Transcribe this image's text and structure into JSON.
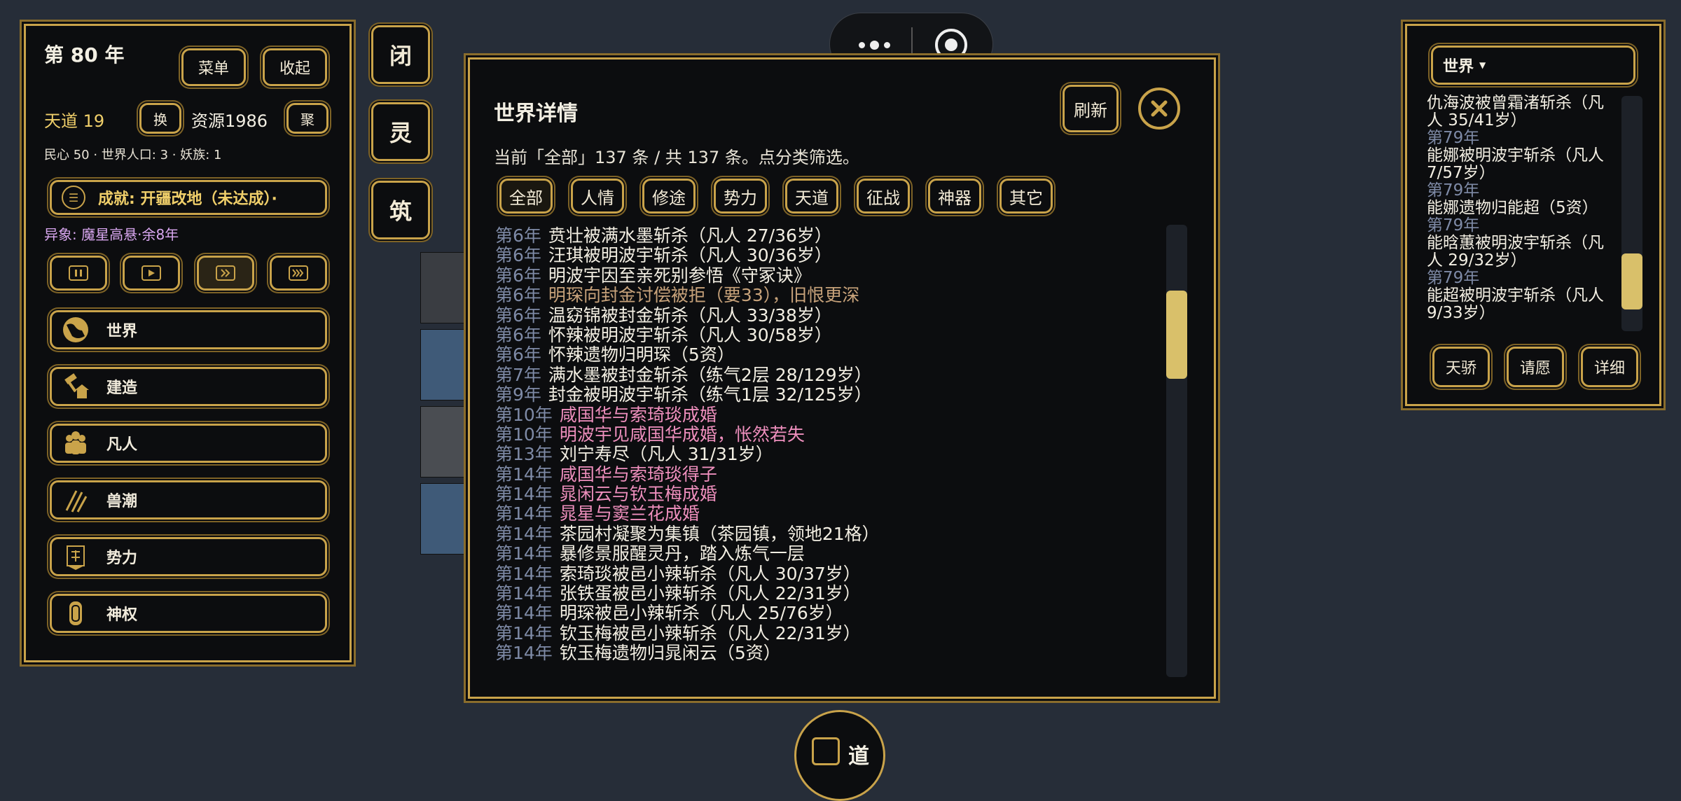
{
  "left": {
    "year": "第 80 年",
    "menu_label": "菜单",
    "collapse_label": "收起",
    "tiandao": "天道 19",
    "swap_label": "换",
    "resource": "资源1986",
    "gather_label": "聚",
    "stats": "民心 50 · 世界人口: 3 · 妖族: 1",
    "achievement": "成就: 开疆改地（未达成）·",
    "omen": "异象: 魔星高悬·余8年",
    "nav": [
      {
        "label": "世界",
        "icon": "globe-icon"
      },
      {
        "label": "建造",
        "icon": "hammer-house-icon"
      },
      {
        "label": "凡人",
        "icon": "people-icon"
      },
      {
        "label": "兽潮",
        "icon": "claw-icon"
      },
      {
        "label": "势力",
        "icon": "banner-icon"
      },
      {
        "label": "神权",
        "icon": "tablet-icon"
      }
    ]
  },
  "side_buttons": [
    "闭",
    "灵",
    "筑"
  ],
  "top_capsule": {
    "more_icon": "more-dots-icon",
    "close_icon": "target-icon"
  },
  "bottom_button": "道",
  "dialog": {
    "title": "世界详情",
    "refresh_label": "刷新",
    "summary": "当前「全部」137 条 / 共 137 条。点分类筛选。",
    "filters": [
      "全部",
      "人情",
      "修途",
      "势力",
      "天道",
      "征战",
      "神器",
      "其它"
    ],
    "log": [
      {
        "year": "第6年",
        "text": "贲壮被满水墨斩杀（凡人 27/36岁）",
        "kind": "normal"
      },
      {
        "year": "第6年",
        "text": "汪琪被明波宇斩杀（凡人 30/36岁）",
        "kind": "normal"
      },
      {
        "year": "第6年",
        "text": "明波宇因至亲死别参悟《守冢诀》",
        "kind": "normal"
      },
      {
        "year": "第6年",
        "text": "明琛向封金讨偿被拒（要33），旧恨更深",
        "kind": "dim"
      },
      {
        "year": "第6年",
        "text": "温窈锦被封金斩杀（凡人 33/38岁）",
        "kind": "normal"
      },
      {
        "year": "第6年",
        "text": "怀辣被明波宇斩杀（凡人 30/58岁）",
        "kind": "normal"
      },
      {
        "year": "第6年",
        "text": "怀辣遗物归明琛（5资）",
        "kind": "normal"
      },
      {
        "year": "第7年",
        "text": "满水墨被封金斩杀（练气2层 28/129岁）",
        "kind": "normal"
      },
      {
        "year": "第9年",
        "text": "封金被明波宇斩杀（练气1层 32/125岁）",
        "kind": "normal"
      },
      {
        "year": "第10年",
        "text": "咸国华与索琦琰成婚",
        "kind": "pink"
      },
      {
        "year": "第10年",
        "text": "明波宇见咸国华成婚，怅然若失",
        "kind": "pink"
      },
      {
        "year": "第13年",
        "text": "刘宁寿尽（凡人 31/31岁）",
        "kind": "normal"
      },
      {
        "year": "第14年",
        "text": "咸国华与索琦琰得子",
        "kind": "pink"
      },
      {
        "year": "第14年",
        "text": "晁闲云与钦玉梅成婚",
        "kind": "pink"
      },
      {
        "year": "第14年",
        "text": "晁星与窦兰花成婚",
        "kind": "pink"
      },
      {
        "year": "第14年",
        "text": "茶园村凝聚为集镇（茶园镇，领地21格）",
        "kind": "normal"
      },
      {
        "year": "第14年",
        "text": "暴修景服醒灵丹，踏入炼气一层",
        "kind": "normal"
      },
      {
        "year": "第14年",
        "text": "索琦琰被邑小辣斩杀（凡人 30/37岁）",
        "kind": "normal"
      },
      {
        "year": "第14年",
        "text": "张铁蛋被邑小辣斩杀（凡人 22/31岁）",
        "kind": "normal"
      },
      {
        "year": "第14年",
        "text": "明琛被邑小辣斩杀（凡人 25/76岁）",
        "kind": "normal"
      },
      {
        "year": "第14年",
        "text": "钦玉梅被邑小辣斩杀（凡人 22/31岁）",
        "kind": "normal"
      },
      {
        "year": "第14年",
        "text": "钦玉梅遗物归晁闲云（5资）",
        "kind": "normal"
      }
    ],
    "scroll_position": 0.18
  },
  "right": {
    "select_value": "世界",
    "entries": [
      {
        "text": "仇海波被曾霜渚斩杀（凡人 35/41岁）"
      },
      {
        "year": "第79年",
        "text": "能娜被明波宇斩杀（凡人 7/57岁）"
      },
      {
        "year": "第79年",
        "text": "能娜遗物归能超（5资）"
      },
      {
        "year": "第79年",
        "text": "能晗蕙被明波宇斩杀（凡人 29/32岁）"
      },
      {
        "year": "第79年",
        "text": "能超被明波宇斩杀（凡人 9/33岁）"
      }
    ],
    "buttons": [
      "天骄",
      "请愿",
      "详细"
    ],
    "scroll_position": 0.88
  },
  "colors": {
    "gold": "#c9a34a",
    "panel": "#0c0d0f",
    "bg": "#262d38",
    "pink": "#ee8fbd",
    "year": "#7e8aa6"
  }
}
